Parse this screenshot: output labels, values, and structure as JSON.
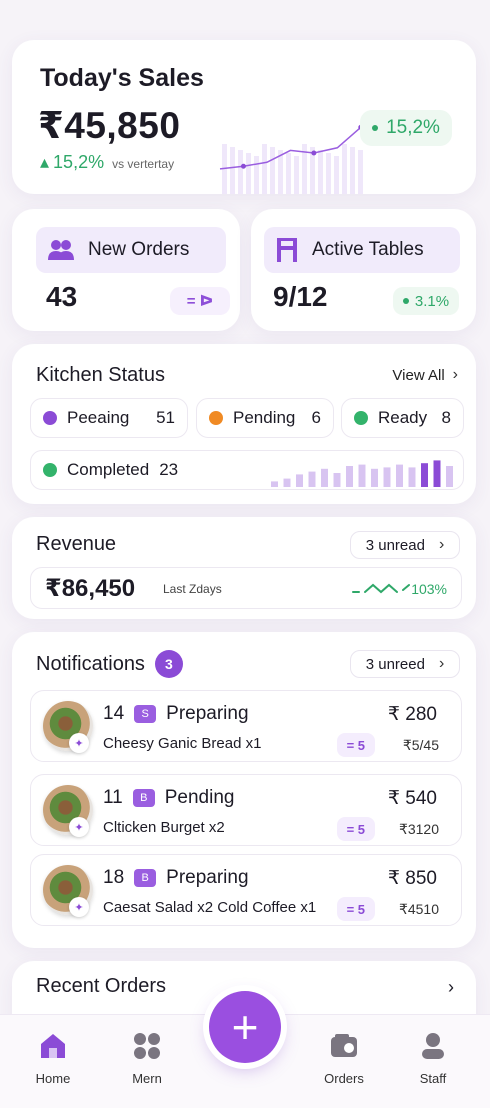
{
  "sales": {
    "title": "Today's Sales",
    "amount": "₹45,850",
    "change": "15,2%",
    "change_note": "vs vertertay",
    "pill_value": "15,2%",
    "spark": [
      0.32,
      0.36,
      0.42,
      0.6,
      0.56,
      0.64,
      0.95
    ]
  },
  "new_orders": {
    "label": "New Orders",
    "icon": "people-icon",
    "value": "43"
  },
  "active_tables": {
    "label": "Active Tables",
    "icon": "table-icon",
    "value": "9/12",
    "pct": "3.1%"
  },
  "kitchen": {
    "title": "Kitchen Status",
    "view_all": "View All",
    "statuses": [
      {
        "label": "Peeaing",
        "count": "51",
        "color": "#8b4bd6"
      },
      {
        "label": "Pending",
        "count": "6",
        "color": "#f08a24"
      },
      {
        "label": "Ready",
        "count": "8",
        "color": "#33b36b"
      },
      {
        "label": "Completed",
        "count": "23",
        "color": "#33b36b"
      }
    ],
    "bars": [
      0.2,
      0.3,
      0.45,
      0.55,
      0.65,
      0.5,
      0.75,
      0.8,
      0.65,
      0.7,
      0.8,
      0.7,
      0.85,
      0.95,
      0.75
    ]
  },
  "revenue": {
    "title": "Revenue",
    "unread": "3 unread",
    "amount": "₹86,450",
    "sub": "Last Zdays",
    "pct": "103%"
  },
  "notifications": {
    "title": "Notifications",
    "badge": "3",
    "unread": "3 unreed",
    "orders": [
      {
        "num": "14",
        "tag": "S",
        "status": "Preparing",
        "item": "Cheesy Ganic Bread x1",
        "price": "₹ 280",
        "qty": "= 5",
        "sub": "₹5/45"
      },
      {
        "num": "11",
        "tag": "B",
        "status": "Pending",
        "item": "Clticken Burget x2",
        "price": "₹ 540",
        "qty": "= 5",
        "sub": "₹3120"
      },
      {
        "num": "18",
        "tag": "B",
        "status": "Preparing",
        "item": "Caesat Salad x2 Cold Coffee x1",
        "price": "₹ 850",
        "qty": "= 5",
        "sub": "₹4510"
      }
    ]
  },
  "recent": {
    "title": "Recent Orders"
  },
  "nav": {
    "home": "Home",
    "menu": "Mern",
    "orders": "Orders",
    "staff": "Staff",
    "fab": "+"
  },
  "colors": {
    "accent": "#9a4fe0",
    "green": "#2fa869",
    "orange": "#f08a24"
  }
}
